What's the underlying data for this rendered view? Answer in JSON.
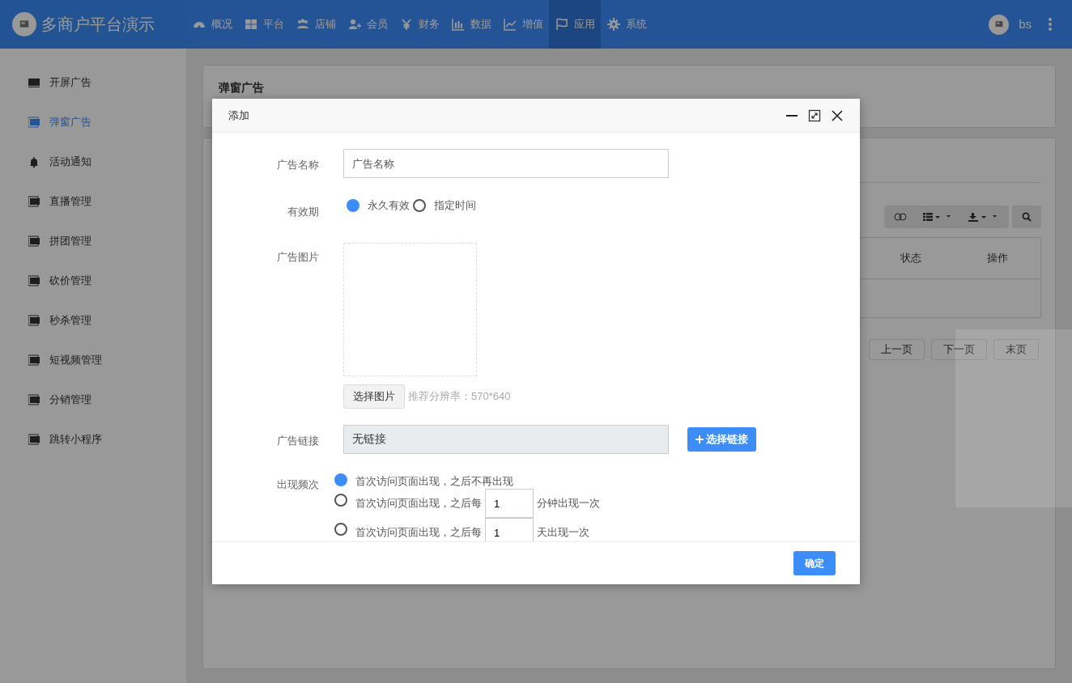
{
  "navbar": {
    "brand": "多商户平台演示",
    "user": "bs",
    "items": [
      {
        "label": "概况",
        "selected": false
      },
      {
        "label": "平台",
        "selected": false
      },
      {
        "label": "店铺",
        "selected": false
      },
      {
        "label": "会员",
        "selected": false
      },
      {
        "label": "财务",
        "selected": false
      },
      {
        "label": "数据",
        "selected": false
      },
      {
        "label": "增值",
        "selected": false
      },
      {
        "label": "应用",
        "selected": true
      },
      {
        "label": "系统",
        "selected": false
      }
    ]
  },
  "sidebar": {
    "items": [
      {
        "label": "开屏广告",
        "selected": false
      },
      {
        "label": "弹窗广告",
        "selected": true
      },
      {
        "label": "活动通知",
        "selected": false
      },
      {
        "label": "直播管理",
        "selected": false
      },
      {
        "label": "拼团管理",
        "selected": false
      },
      {
        "label": "砍价管理",
        "selected": false
      },
      {
        "label": "秒杀管理",
        "selected": false
      },
      {
        "label": "短视频管理",
        "selected": false
      },
      {
        "label": "分销管理",
        "selected": false
      },
      {
        "label": "跳转小程序",
        "selected": false
      }
    ]
  },
  "page": {
    "title": "弹窗广告",
    "table": {
      "columns": [
        "状态",
        "操作"
      ]
    },
    "pagination": [
      "上一页",
      "下一页",
      "末页"
    ]
  },
  "dialog": {
    "title": "添加",
    "confirm": "确定",
    "fields": [
      {
        "kind": "text",
        "label": "广告名称",
        "placeholder": "广告名称"
      },
      {
        "kind": "radio",
        "label": "有效期",
        "options": [
          {
            "label": "永久有效",
            "selected": true
          },
          {
            "label": "指定时间",
            "selected": false
          }
        ]
      },
      {
        "kind": "image",
        "label": "广告图片",
        "button": "选择图片",
        "hint": "推荐分辨率：570*640"
      },
      {
        "kind": "link",
        "label": "广告链接",
        "value": "无链接",
        "button": "选择链接"
      },
      {
        "kind": "frequency",
        "label": "出现频次",
        "options": [
          {
            "text": "首次访问页面出现，之后不再出现",
            "selected": true
          },
          {
            "before": "首次访问页面出现，之后每",
            "value": "1",
            "after": "分钟出现一次",
            "selected": false
          },
          {
            "before": "首次访问页面出现，之后每",
            "value": "1",
            "after": "天出现一次",
            "selected": false
          }
        ]
      }
    ]
  }
}
